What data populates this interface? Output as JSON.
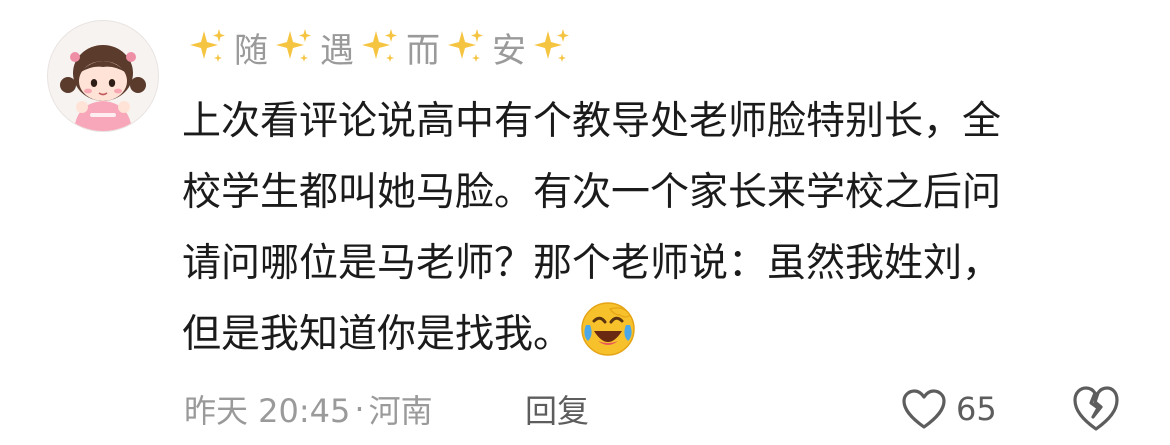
{
  "comment": {
    "user": {
      "name_chars": [
        "随",
        "遇",
        "而",
        "安"
      ]
    },
    "content_lines": [
      "上次看评论说高中有个教导处老师脸特别长，全",
      "校学生都叫她马脸。有次一个家长来学校之后问",
      "请问哪位是马老师？那个老师说：虽然我姓刘，",
      "但是我知道你是找我。"
    ],
    "emoji": "laughing-crying-emoji",
    "time": "昨天 20:45",
    "separator": "·",
    "location": "河南",
    "reply_label": "回复",
    "like_count": "65",
    "icons": {
      "like": "heart-outline-icon",
      "dislike": "broken-heart-outline-icon",
      "sparkle": "sparkles-icon"
    },
    "colors": {
      "text": "#1b1b1b",
      "meta": "#9a9a9a",
      "action": "#5d5d5d",
      "sparkle": "#f5c542"
    }
  }
}
